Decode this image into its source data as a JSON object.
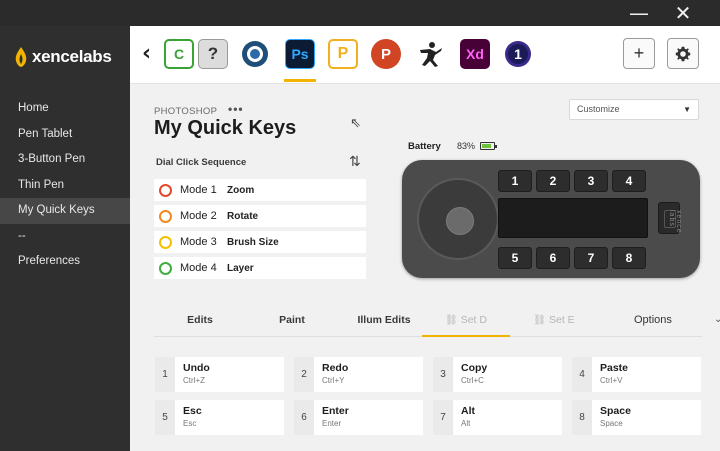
{
  "window": {
    "minimize_glyph": "—",
    "close_glyph": "✕"
  },
  "brand": {
    "name": "xencelabs",
    "logo_icon": "flame-logo-icon",
    "accent": "#f2b400"
  },
  "sidebar": {
    "items": [
      {
        "label": "Home",
        "active": false
      },
      {
        "label": "Pen Tablet",
        "active": false
      },
      {
        "label": "3-Button Pen",
        "active": false
      },
      {
        "label": "Thin Pen",
        "active": false
      },
      {
        "label": "My Quick Keys",
        "active": true
      },
      {
        "label": "--",
        "active": false
      },
      {
        "label": "Preferences",
        "active": false
      }
    ]
  },
  "appbar": {
    "back_glyph": "‹",
    "apps": [
      {
        "label": "C",
        "icon": "camtasia-icon",
        "color": "#3aa335"
      },
      {
        "label": "?",
        "icon": "help-icon",
        "color": "#dcdcdc"
      },
      {
        "label": "",
        "icon": "capture-one-icon",
        "color": "#1f4e79"
      },
      {
        "label": "Ps",
        "icon": "photoshop-icon",
        "color": "#0a1b33",
        "selected": true
      },
      {
        "label": "P",
        "icon": "presenter-icon",
        "color": "#f0b020"
      },
      {
        "label": "P",
        "icon": "powerpoint-icon",
        "color": "#d14424"
      },
      {
        "label": "",
        "icon": "zbrush-icon",
        "color": "#ffffff"
      },
      {
        "label": "Xd",
        "icon": "adobe-xd-icon",
        "color": "#470137"
      },
      {
        "label": "1",
        "icon": "affinity-icon",
        "color": "#1b1b5a"
      }
    ],
    "add_glyph": "+",
    "settings_icon": "gear-icon"
  },
  "header": {
    "app_caption": "PHOTOSHOP",
    "more_glyph": "•••",
    "title": "My Quick Keys",
    "profile_select": "Customize"
  },
  "dial": {
    "title": "Dial Click Sequence",
    "swap_glyph": "⇅",
    "modes": [
      {
        "mode": "Mode 1",
        "function": "Zoom",
        "color": "#e04a2b"
      },
      {
        "mode": "Mode 2",
        "function": "Rotate",
        "color": "#ef8a1e"
      },
      {
        "mode": "Mode 3",
        "function": "Brush Size",
        "color": "#f2c200"
      },
      {
        "mode": "Mode 4",
        "function": "Layer",
        "color": "#3fae3f"
      }
    ]
  },
  "battery": {
    "label": "Battery",
    "percent": "83%",
    "level": 0.83,
    "color": "#6ac23b"
  },
  "device": {
    "top_keys": [
      "1",
      "2",
      "3",
      "4"
    ],
    "bottom_keys": [
      "5",
      "6",
      "7",
      "8"
    ],
    "brand": "xence labs"
  },
  "tabs": {
    "items": [
      {
        "label": "Edits",
        "state": "normal"
      },
      {
        "label": "Paint",
        "state": "normal"
      },
      {
        "label": "Illum Edits",
        "state": "normal"
      },
      {
        "label": "Set D",
        "state": "disabled-active"
      },
      {
        "label": "Set E",
        "state": "disabled"
      }
    ],
    "link_glyph": "⛓",
    "options_label": "Options",
    "options_chevron": "⌄"
  },
  "keys": [
    {
      "num": "1",
      "name": "Undo",
      "shortcut": "Ctrl+Z"
    },
    {
      "num": "2",
      "name": "Redo",
      "shortcut": "Ctrl+Y"
    },
    {
      "num": "3",
      "name": "Copy",
      "shortcut": "Ctrl+C"
    },
    {
      "num": "4",
      "name": "Paste",
      "shortcut": "Ctrl+V"
    },
    {
      "num": "5",
      "name": "Esc",
      "shortcut": "Esc"
    },
    {
      "num": "6",
      "name": "Enter",
      "shortcut": "Enter"
    },
    {
      "num": "7",
      "name": "Alt",
      "shortcut": "Alt"
    },
    {
      "num": "8",
      "name": "Space",
      "shortcut": "Space"
    }
  ]
}
